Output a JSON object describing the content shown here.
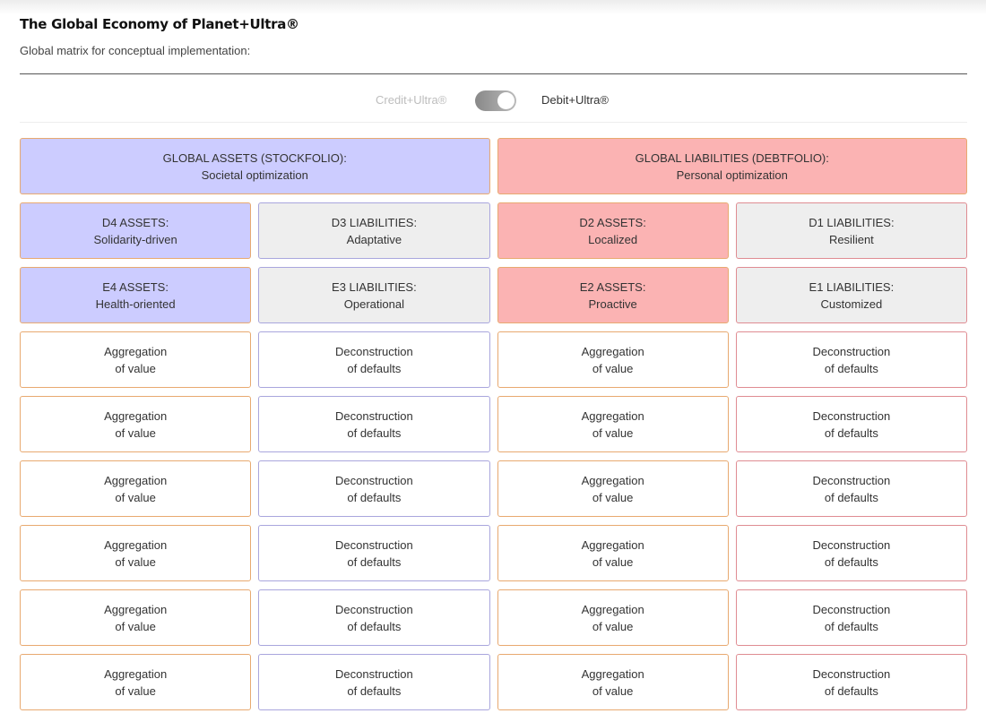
{
  "header": {
    "title": "The Global Economy of Planet+Ultra®",
    "subtitle": "Global matrix for conceptual implementation:"
  },
  "toggle": {
    "left_label": "Credit+Ultra®",
    "right_label": "Debit+Ultra®",
    "state": "right"
  },
  "colors": {
    "assets_blue": "#ccccff",
    "liabilities_red": "#fbb3b3",
    "neutral_grey": "#eeeeee",
    "border_orange": "#e8a970",
    "border_purple": "#a9a6dd",
    "border_red": "#df8c92"
  },
  "matrix": {
    "global": [
      {
        "line1": "GLOBAL ASSETS (STOCKFOLIO):",
        "line2": "Societal optimization"
      },
      {
        "line1": "GLOBAL LIABILITIES (DEBTFOLIO):",
        "line2": "Personal optimization"
      }
    ],
    "d_row": [
      {
        "line1": "D4 ASSETS:",
        "line2": "Solidarity-driven"
      },
      {
        "line1": "D3 LIABILITIES:",
        "line2": "Adaptative"
      },
      {
        "line1": "D2 ASSETS:",
        "line2": "Localized"
      },
      {
        "line1": "D1 LIABILITIES:",
        "line2": "Resilient"
      }
    ],
    "e_row": [
      {
        "line1": "E4 ASSETS:",
        "line2": "Health-oriented"
      },
      {
        "line1": "E3 LIABILITIES:",
        "line2": "Operational"
      },
      {
        "line1": "E2 ASSETS:",
        "line2": "Proactive"
      },
      {
        "line1": "E1 LIABILITIES:",
        "line2": "Customized"
      }
    ],
    "detail_rows": [
      [
        {
          "line1": "Aggregation",
          "line2": "of value"
        },
        {
          "line1": "Deconstruction",
          "line2": "of defaults"
        },
        {
          "line1": "Aggregation",
          "line2": "of value"
        },
        {
          "line1": "Deconstruction",
          "line2": "of defaults"
        }
      ],
      [
        {
          "line1": "Aggregation",
          "line2": "of value"
        },
        {
          "line1": "Deconstruction",
          "line2": "of defaults"
        },
        {
          "line1": "Aggregation",
          "line2": "of value"
        },
        {
          "line1": "Deconstruction",
          "line2": "of defaults"
        }
      ],
      [
        {
          "line1": "Aggregation",
          "line2": "of value"
        },
        {
          "line1": "Deconstruction",
          "line2": "of defaults"
        },
        {
          "line1": "Aggregation",
          "line2": "of value"
        },
        {
          "line1": "Deconstruction",
          "line2": "of defaults"
        }
      ],
      [
        {
          "line1": "Aggregation",
          "line2": "of value"
        },
        {
          "line1": "Deconstruction",
          "line2": "of defaults"
        },
        {
          "line1": "Aggregation",
          "line2": "of value"
        },
        {
          "line1": "Deconstruction",
          "line2": "of defaults"
        }
      ],
      [
        {
          "line1": "Aggregation",
          "line2": "of value"
        },
        {
          "line1": "Deconstruction",
          "line2": "of defaults"
        },
        {
          "line1": "Aggregation",
          "line2": "of value"
        },
        {
          "line1": "Deconstruction",
          "line2": "of defaults"
        }
      ],
      [
        {
          "line1": "Aggregation",
          "line2": "of value"
        },
        {
          "line1": "Deconstruction",
          "line2": "of defaults"
        },
        {
          "line1": "Aggregation",
          "line2": "of value"
        },
        {
          "line1": "Deconstruction",
          "line2": "of defaults"
        }
      ]
    ]
  }
}
